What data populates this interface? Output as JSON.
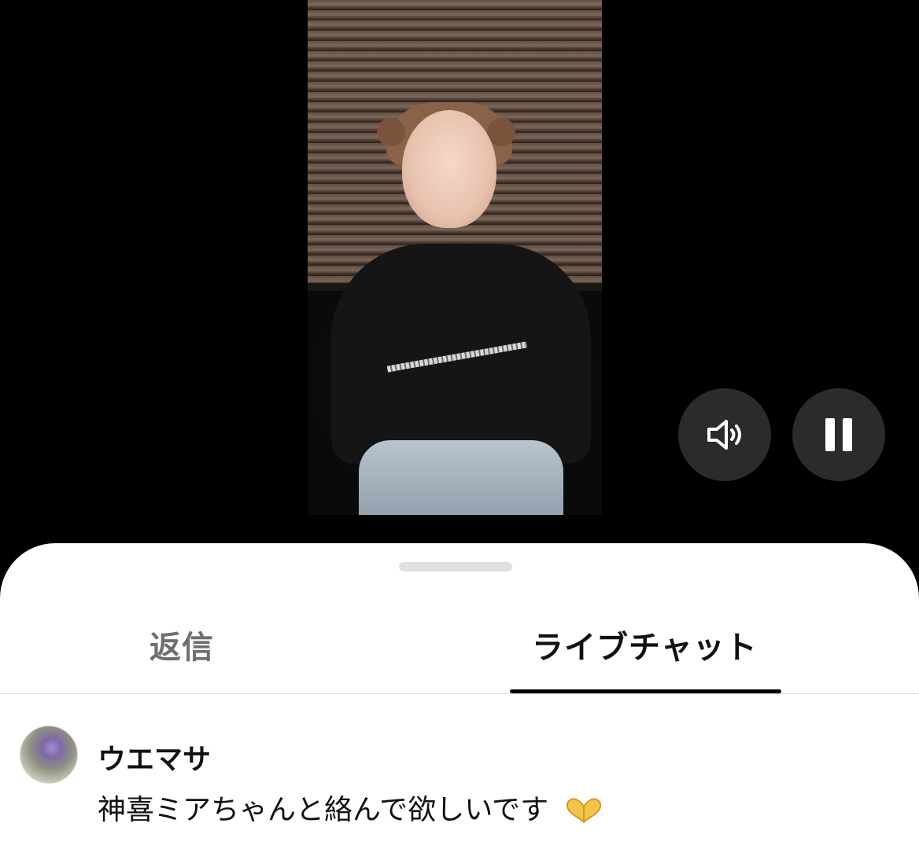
{
  "tabs": {
    "replies": "返信",
    "live_chat": "ライブチャット",
    "active": "live_chat"
  },
  "controls": {
    "sound_icon": "speaker-icon",
    "pause_icon": "pause-icon"
  },
  "comment": {
    "username": "ウエマサ",
    "text": "神喜ミアちゃんと絡んで欲しいです",
    "emoji": "heart-hands-emoji"
  },
  "colors": {
    "sheet_bg": "#ffffff",
    "control_bg": "#2a2b2d",
    "active_tab": "#111111",
    "inactive_tab": "#6f6f6f"
  }
}
